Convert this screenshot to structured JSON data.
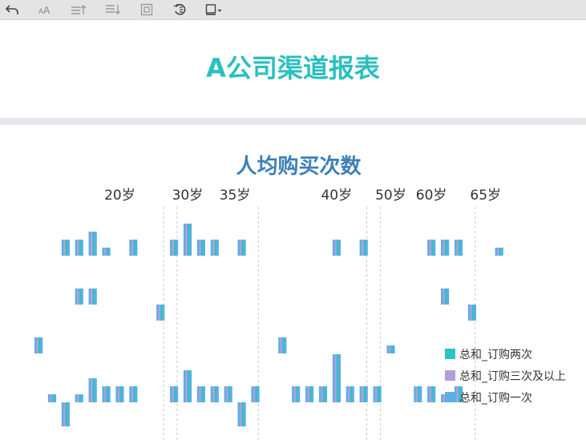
{
  "report": {
    "title": "A公司渠道报表"
  },
  "toolbar": {
    "buttons": [
      {
        "name": "undo-icon"
      },
      {
        "name": "font-size-icon"
      },
      {
        "name": "sort-ascending-icon"
      },
      {
        "name": "sort-descending-icon"
      },
      {
        "name": "fit-frame-icon"
      },
      {
        "name": "reset-icon"
      },
      {
        "name": "display-mode-icon"
      }
    ]
  },
  "chart_data": {
    "type": "bar",
    "title": "人均购买次数",
    "group_labels": [
      {
        "label": "20岁",
        "at": 6
      },
      {
        "label": "30岁",
        "at": 11
      },
      {
        "label": "35岁",
        "at": 14.5
      },
      {
        "label": "40岁",
        "at": 22
      },
      {
        "label": "50岁",
        "at": 26
      },
      {
        "label": "60岁",
        "at": 29
      },
      {
        "label": "65岁",
        "at": 33
      }
    ],
    "group_separators": [
      9,
      10,
      16,
      24,
      25,
      32
    ],
    "legend": {
      "position": "bottom-right"
    },
    "colors": {
      "two": "#2bc4c4",
      "three": "#b39ddb",
      "one": "#5dade8",
      "separator": "#c8c8c8"
    },
    "series": [
      {
        "name": "总和_订购两次",
        "color": "#2bc4c4"
      },
      {
        "name": "总和_订购三次及以上",
        "color": "#b39ddb"
      },
      {
        "name": "总和_订购一次",
        "color": "#5dade8"
      }
    ],
    "bands": [
      {
        "values": [
          0,
          0,
          2,
          2,
          3,
          1,
          0,
          2,
          0,
          0,
          2,
          4,
          2,
          2,
          0,
          2,
          0,
          0,
          0,
          0,
          0,
          0,
          2,
          0,
          2,
          0,
          0,
          0,
          0,
          2,
          2,
          2,
          0,
          0,
          1
        ]
      },
      {
        "values": [
          0,
          0,
          0,
          2,
          2,
          0,
          0,
          0,
          0,
          -2,
          0,
          0,
          0,
          0,
          0,
          0,
          0,
          0,
          0,
          0,
          0,
          0,
          0,
          0,
          0,
          0,
          0,
          0,
          0,
          0,
          2,
          0,
          -2,
          0,
          0
        ]
      },
      {
        "values": [
          2,
          0,
          0,
          0,
          0,
          0,
          0,
          0,
          0,
          0,
          0,
          0,
          0,
          0,
          0,
          0,
          0,
          0,
          2,
          0,
          0,
          0,
          0,
          0,
          0,
          0,
          1,
          0,
          0,
          0,
          0,
          0,
          0,
          0,
          0
        ]
      },
      {
        "values": [
          0,
          1,
          -3,
          1,
          3,
          2,
          2,
          2,
          0,
          0,
          2,
          4,
          2,
          2,
          2,
          -3,
          2,
          0,
          0,
          2,
          2,
          2,
          6,
          2,
          2,
          2,
          0,
          0,
          2,
          2,
          1,
          2,
          0,
          0,
          0
        ]
      }
    ]
  }
}
